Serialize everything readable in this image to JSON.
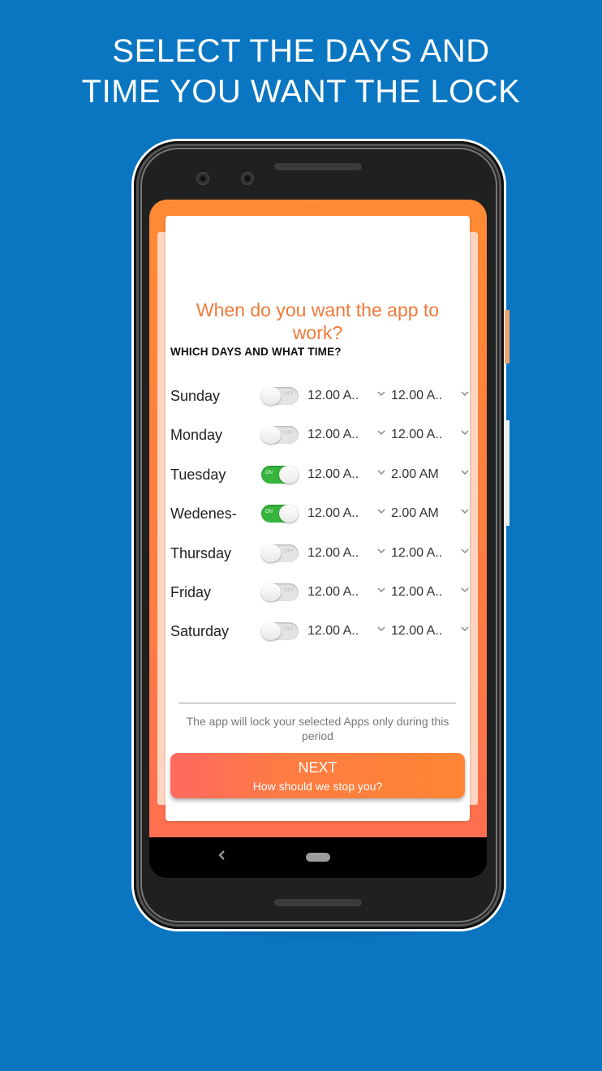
{
  "headline": {
    "line1": "SELECT THE DAYS AND",
    "line2": "TIME YOU WANT THE LOCK"
  },
  "colors": {
    "background": "#0a76c2",
    "accent_orange": "#ff8534",
    "title_orange": "#f07a3a",
    "toggle_on": "#36b53c"
  },
  "screen": {
    "title": "When do you want the app to work?",
    "section_label": "WHICH DAYS AND WHAT TIME?",
    "days": [
      {
        "name": "Sunday",
        "enabled": false,
        "toggle_text": "OFF",
        "start": "12.00 A..",
        "end": "12.00 A.."
      },
      {
        "name": "Monday",
        "enabled": false,
        "toggle_text": "OFF",
        "start": "12.00 A..",
        "end": "12.00 A.."
      },
      {
        "name": "Tuesday",
        "enabled": true,
        "toggle_text": "ON",
        "start": "12.00 A..",
        "end": "2.00 AM"
      },
      {
        "name": "Wedenes-",
        "enabled": true,
        "toggle_text": "ON",
        "start": "12.00 A..",
        "end": "2.00 AM"
      },
      {
        "name": "Thursday",
        "enabled": false,
        "toggle_text": "OFF",
        "start": "12.00 A..",
        "end": "12.00 A.."
      },
      {
        "name": "Friday",
        "enabled": false,
        "toggle_text": "OFF",
        "start": "12.00 A..",
        "end": "12.00 A.."
      },
      {
        "name": "Saturday",
        "enabled": false,
        "toggle_text": "OFF",
        "start": "12.00 A..",
        "end": "12.00 A.."
      }
    ],
    "footnote": "The app will lock your selected Apps only during this period",
    "next_button": {
      "label": "NEXT",
      "sublabel": "How should we stop you?"
    }
  },
  "navbar": {
    "back_icon": "chevron-left-icon",
    "home_icon": "home-pill-icon"
  }
}
